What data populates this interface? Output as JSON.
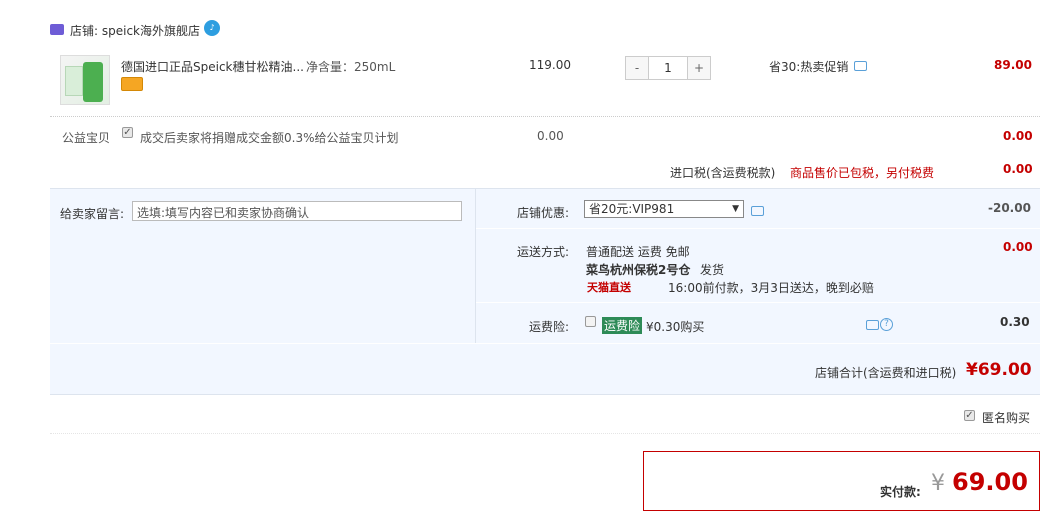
{
  "shop": {
    "label": "店铺: speick海外旗舰店",
    "badge": "国际"
  },
  "item": {
    "title": "德国进口正品Speick穗甘松精油...",
    "spec": "净含量：250mL",
    "price": "119.00",
    "quantity": "1",
    "minus": "-",
    "plus": "+",
    "promo": "省30:热卖促销",
    "subtotal": "89.00"
  },
  "charity": {
    "label": "公益宝贝",
    "text": "成交后卖家将捐赠成交金额0.3%给公益宝贝计划",
    "price": "0.00",
    "subtotal": "0.00"
  },
  "tax": {
    "label": "进口税(含运费税款)",
    "note": "商品售价已包税，另付税费",
    "amount": "0.00"
  },
  "message": {
    "label": "给卖家留言:",
    "placeholder": "选填:填写内容已和卖家协商确认"
  },
  "coupon": {
    "label": "店铺优惠:",
    "selected": "省20元:VIP981",
    "amount": "-20.00"
  },
  "shipping": {
    "label": "运送方式:",
    "method": "普通配送 运费 免邮",
    "warehouse": "菜鸟杭州保税2号仓",
    "dispatch": "发货",
    "tmall_tag": "天猫直送",
    "promise": "16:00前付款，3月3日送达，晚到必赔",
    "amount": "0.00"
  },
  "insurance": {
    "label": "运费险:",
    "tag": "运费险",
    "price_text": "¥0.30购买",
    "amount": "0.30"
  },
  "store_total": {
    "label": "店铺合计(含运费和进口税)",
    "value": "¥69.00"
  },
  "anonymous": {
    "label": "匿名购买"
  },
  "payment": {
    "label": "实付款:",
    "currency": "¥",
    "value": "69.00"
  },
  "colors": {
    "accent": "#c40000",
    "panel": "#f2f7ff",
    "link": "#2d9ee0"
  }
}
